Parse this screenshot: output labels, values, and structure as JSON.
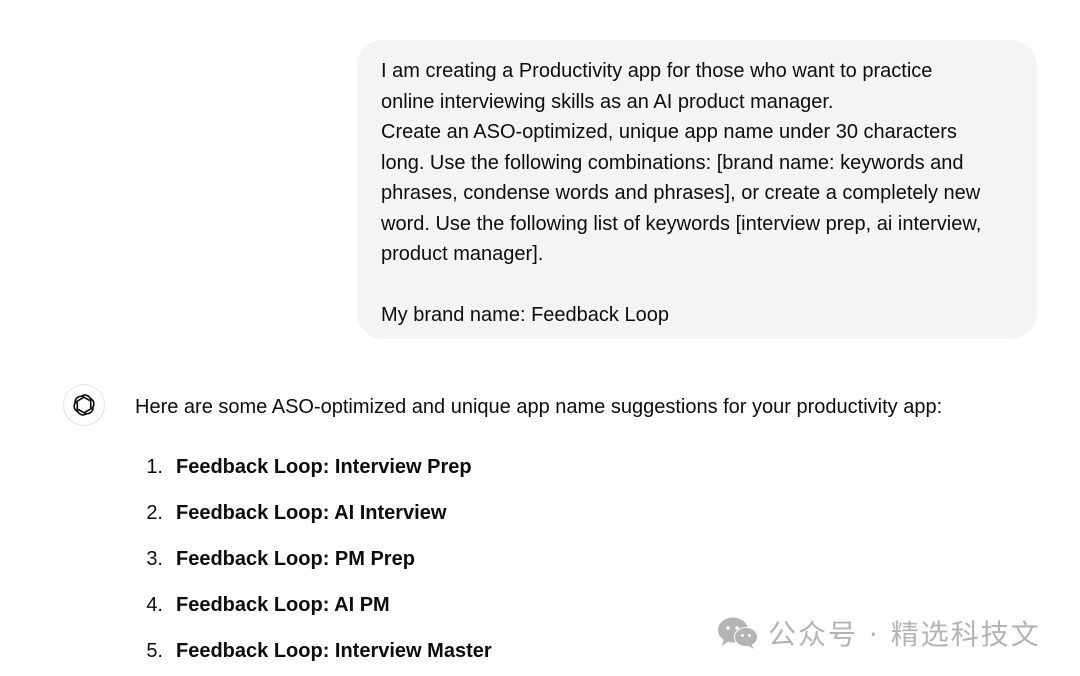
{
  "conversation": {
    "user_message": {
      "lines_paragraph_1": [
        "I am creating a Productivity app for those who want to practice",
        "online interviewing skills as an AI product manager.",
        "Create an ASO-optimized, unique app name under 30 characters",
        "long. Use the following combinations: [brand name: keywords and",
        "phrases, condense words and phrases], or create a completely new",
        "word. Use the following list of keywords [interview prep, ai interview,",
        "product manager]."
      ],
      "line_paragraph_2": "My brand name: Feedback Loop"
    },
    "assistant_message": {
      "avatar_icon": "openai-logo-icon",
      "intro": "Here are some ASO-optimized and unique app name suggestions for your productivity app:",
      "suggestions": [
        {
          "number": "1.",
          "name": "Feedback Loop: Interview Prep"
        },
        {
          "number": "2.",
          "name": "Feedback Loop: AI Interview"
        },
        {
          "number": "3.",
          "name": "Feedback Loop: PM Prep"
        },
        {
          "number": "4.",
          "name": "Feedback Loop: AI PM"
        },
        {
          "number": "5.",
          "name": "Feedback Loop: Interview Master"
        }
      ]
    }
  },
  "watermark": {
    "icon": "wechat-icon",
    "text": "公众号 · 精选科技文"
  },
  "colors": {
    "user_bubble_bg": "#f4f4f4",
    "text": "#0d0d0d",
    "watermark": "#b4b4b4"
  }
}
